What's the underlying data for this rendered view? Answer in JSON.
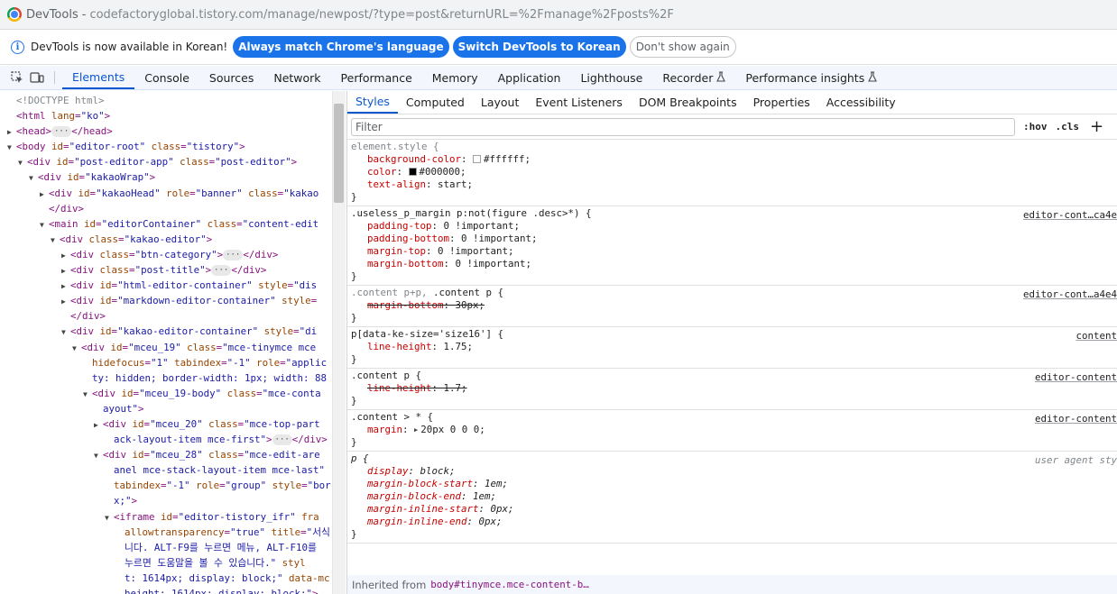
{
  "window": {
    "app_name": "DevTools",
    "separator": "-",
    "url": "codefactoryglobal.tistory.com/manage/newpost/?type=post&returnURL=%2Fmanage%2Fposts%2F"
  },
  "infobar": {
    "message": "DevTools is now available in Korean!",
    "btn_match": "Always match Chrome's language",
    "btn_switch": "Switch DevTools to Korean",
    "btn_dismiss": "Don't show again"
  },
  "main_tabs": [
    {
      "label": "Elements",
      "active": true
    },
    {
      "label": "Console"
    },
    {
      "label": "Sources"
    },
    {
      "label": "Network"
    },
    {
      "label": "Performance"
    },
    {
      "label": "Memory"
    },
    {
      "label": "Application"
    },
    {
      "label": "Lighthouse"
    },
    {
      "label": "Recorder",
      "flask": true
    },
    {
      "label": "Performance insights",
      "flask": true
    }
  ],
  "sub_tabs": [
    {
      "label": "Styles",
      "active": true
    },
    {
      "label": "Computed"
    },
    {
      "label": "Layout"
    },
    {
      "label": "Event Listeners"
    },
    {
      "label": "DOM Breakpoints"
    },
    {
      "label": "Properties"
    },
    {
      "label": "Accessibility"
    }
  ],
  "filter": {
    "placeholder": "Filter",
    "hov": ":hov",
    "cls": ".cls",
    "add": "+"
  },
  "dom_lines": [
    {
      "indent": 0,
      "html": "<span class='doctype'>&lt;!DOCTYPE html&gt;</span>"
    },
    {
      "indent": 0,
      "html": "<span class='tag'>&lt;html</span> <span class='attr'>lang</span><span class='tag'>=</span><span class='val'>\"ko\"</span><span class='tag'>&gt;</span>"
    },
    {
      "indent": 0,
      "tri": "▶",
      "html": "<span class='tag'>&lt;head&gt;</span><span class='ellipsis'>···</span><span class='tag'>&lt;/head&gt;</span>"
    },
    {
      "indent": 0,
      "tri": "▼",
      "html": "<span class='tag'>&lt;body</span> <span class='attr'>id</span><span class='tag'>=</span><span class='val'>\"editor-root\"</span> <span class='attr'>class</span><span class='tag'>=</span><span class='val'>\"tistory\"</span><span class='tag'>&gt;</span>"
    },
    {
      "indent": 1,
      "tri": "▼",
      "html": "<span class='tag'>&lt;div</span> <span class='attr'>id</span><span class='tag'>=</span><span class='val'>\"post-editor-app\"</span> <span class='attr'>class</span><span class='tag'>=</span><span class='val'>\"post-editor\"</span><span class='tag'>&gt;</span>"
    },
    {
      "indent": 2,
      "tri": "▼",
      "html": "<span class='tag'>&lt;div</span> <span class='attr'>id</span><span class='tag'>=</span><span class='val'>\"kakaoWrap\"</span><span class='tag'>&gt;</span>"
    },
    {
      "indent": 3,
      "tri": "▶",
      "html": "<span class='tag'>&lt;div</span> <span class='attr'>id</span><span class='tag'>=</span><span class='val'>\"kakaoHead\"</span> <span class='attr'>role</span><span class='tag'>=</span><span class='val'>\"banner\"</span> <span class='attr'>class</span><span class='tag'>=</span><span class='val'>\"kakao</span>"
    },
    {
      "indent": 3,
      "html": "<span class='tag'>&lt;/div&gt;</span>"
    },
    {
      "indent": 3,
      "tri": "▼",
      "html": "<span class='tag'>&lt;main</span> <span class='attr'>id</span><span class='tag'>=</span><span class='val'>\"editorContainer\"</span> <span class='attr'>class</span><span class='tag'>=</span><span class='val'>\"content-edit</span>"
    },
    {
      "indent": 4,
      "tri": "▼",
      "html": "<span class='tag'>&lt;div</span> <span class='attr'>class</span><span class='tag'>=</span><span class='val'>\"kakao-editor\"</span><span class='tag'>&gt;</span>"
    },
    {
      "indent": 5,
      "tri": "▶",
      "html": "<span class='tag'>&lt;div</span> <span class='attr'>class</span><span class='tag'>=</span><span class='val'>\"btn-category\"</span><span class='tag'>&gt;</span><span class='ellipsis'>···</span><span class='tag'>&lt;/div&gt;</span>"
    },
    {
      "indent": 5,
      "tri": "▶",
      "html": "<span class='tag'>&lt;div</span> <span class='attr'>class</span><span class='tag'>=</span><span class='val'>\"post-title\"</span><span class='tag'>&gt;</span><span class='ellipsis'>···</span><span class='tag'>&lt;/div&gt;</span>"
    },
    {
      "indent": 5,
      "tri": "▶",
      "html": "<span class='tag'>&lt;div</span> <span class='attr'>id</span><span class='tag'>=</span><span class='val'>\"html-editor-container\"</span> <span class='attr'>style</span><span class='tag'>=</span><span class='val'>\"dis</span>"
    },
    {
      "indent": 5,
      "tri": "▶",
      "html": "<span class='tag'>&lt;div</span> <span class='attr'>id</span><span class='tag'>=</span><span class='val'>\"markdown-editor-container\"</span> <span class='attr'>style</span><span class='tag'>=</span>"
    },
    {
      "indent": 5,
      "html": "<span class='tag'>&lt;/div&gt;</span>"
    },
    {
      "indent": 5,
      "tri": "▼",
      "html": "<span class='tag'>&lt;div</span> <span class='attr'>id</span><span class='tag'>=</span><span class='val'>\"kakao-editor-container\"</span> <span class='attr'>style</span><span class='tag'>=</span><span class='val'>\"di</span>"
    },
    {
      "indent": 6,
      "tri": "▼",
      "html": "<span class='tag'>&lt;div</span> <span class='attr'>id</span><span class='tag'>=</span><span class='val'>\"mceu_19\"</span> <span class='attr'>class</span><span class='tag'>=</span><span class='val'>\"mce-tinymce mce</span>"
    },
    {
      "indent": 7,
      "html": "<span class='attr'>hidefocus</span><span class='tag'>=</span><span class='val'>\"1\"</span> <span class='attr'>tabindex</span><span class='tag'>=</span><span class='val'>\"-1\"</span> <span class='attr'>role</span><span class='tag'>=</span><span class='val'>\"applic</span>"
    },
    {
      "indent": 7,
      "html": "<span class='val'>ty: hidden; border-width: 1px; width: 88</span>"
    },
    {
      "indent": 7,
      "tri": "▼",
      "html": "<span class='tag'>&lt;div</span> <span class='attr'>id</span><span class='tag'>=</span><span class='val'>\"mceu_19-body\"</span> <span class='attr'>class</span><span class='tag'>=</span><span class='val'>\"mce-conta</span>"
    },
    {
      "indent": 8,
      "html": "<span class='val'>ayout\"</span><span class='tag'>&gt;</span>"
    },
    {
      "indent": 8,
      "tri": "▶",
      "html": "<span class='tag'>&lt;div</span> <span class='attr'>id</span><span class='tag'>=</span><span class='val'>\"mceu_20\"</span> <span class='attr'>class</span><span class='tag'>=</span><span class='val'>\"mce-top-part</span>"
    },
    {
      "indent": 9,
      "html": "<span class='val'>ack-layout-item mce-first\"</span><span class='tag'>&gt;</span><span class='ellipsis'>···</span><span class='tag'>&lt;/div&gt;</span>"
    },
    {
      "indent": 8,
      "tri": "▼",
      "html": "<span class='tag'>&lt;div</span> <span class='attr'>id</span><span class='tag'>=</span><span class='val'>\"mceu_28\"</span> <span class='attr'>class</span><span class='tag'>=</span><span class='val'>\"mce-edit-are</span>"
    },
    {
      "indent": 9,
      "html": "<span class='val'>anel mce-stack-layout-item mce-last\"</span>"
    },
    {
      "indent": 9,
      "html": "<span class='attr'>tabindex</span><span class='tag'>=</span><span class='val'>\"-1\"</span> <span class='attr'>role</span><span class='tag'>=</span><span class='val'>\"group\"</span> <span class='attr'>style</span><span class='tag'>=</span><span class='val'>\"bor</span>"
    },
    {
      "indent": 9,
      "html": "<span class='val'>x;\"</span><span class='tag'>&gt;</span>"
    },
    {
      "indent": 9,
      "tri": "▼",
      "html": "<span class='tag'>&lt;iframe</span> <span class='attr'>id</span><span class='tag'>=</span><span class='val'>\"editor-tistory_ifr\"</span> <span class='attr'>fra</span>"
    },
    {
      "indent": 10,
      "html": "<span class='attr'>allowtransparency</span><span class='tag'>=</span><span class='val'>\"true\"</span> <span class='attr'>title</span><span class='tag'>=</span><span class='val'>\"서식</span>"
    },
    {
      "indent": 10,
      "html": "<span class='val'>니다. ALT-F9를 누르면 메뉴, ALT-F10를</span>"
    },
    {
      "indent": 10,
      "html": "<span class='val'>누르면 도움말을 볼 수 있습니다.\"</span> <span class='attr'>styl</span>"
    },
    {
      "indent": 10,
      "html": "<span class='val'>t: 1614px; display: block;\"</span> <span class='attr'>data-mc</span>"
    },
    {
      "indent": 10,
      "html": "<span class='val'>height: 1614px; display: block;\"</span><span class='tag'>&gt;</span>"
    }
  ],
  "rules": [
    {
      "selector": "element.style {",
      "dim": true,
      "decls": [
        {
          "prop": "background-color",
          "value": "#ffffff",
          "swatch": "#ffffff"
        },
        {
          "prop": "color",
          "value": "#000000",
          "swatch": "#000000"
        },
        {
          "prop": "text-align",
          "value": "start"
        }
      ]
    },
    {
      "selector": ".useless_p_margin p:not(figure .desc>*) {",
      "source": "editor-cont…ca4e",
      "decls": [
        {
          "prop": "padding-top",
          "value": "0 !important"
        },
        {
          "prop": "padding-bottom",
          "value": "0 !important"
        },
        {
          "prop": "margin-top",
          "value": "0 !important"
        },
        {
          "prop": "margin-bottom",
          "value": "0 !important"
        }
      ]
    },
    {
      "selector_dim": ".content p+p,",
      "selector": " .content p {",
      "source": "editor-cont…a4e4",
      "decls": [
        {
          "prop": "margin-bottom",
          "value": "30px",
          "struck": true
        }
      ]
    },
    {
      "selector": "p[data-ke-size='size16'] {",
      "source": "content",
      "decls": [
        {
          "prop": "line-height",
          "value": "1.75"
        }
      ]
    },
    {
      "selector": ".content p {",
      "source": "editor-content",
      "decls": [
        {
          "prop": "line-height",
          "value": "1.7",
          "struck": true
        }
      ]
    },
    {
      "selector": ".content > * {",
      "source": "editor-content",
      "decls": [
        {
          "prop": "margin",
          "value": "20px 0 0 0",
          "expander": true
        }
      ]
    },
    {
      "selector": "p {",
      "source": "user agent sty",
      "agent": true,
      "italic": true,
      "decls": [
        {
          "prop": "display",
          "value": "block"
        },
        {
          "prop": "margin-block-start",
          "value": "1em"
        },
        {
          "prop": "margin-block-end",
          "value": "1em"
        },
        {
          "prop": "margin-inline-start",
          "value": "0px"
        },
        {
          "prop": "margin-inline-end",
          "value": "0px"
        }
      ]
    }
  ],
  "inherited": {
    "label": "Inherited from",
    "selector": "body#tinymce.mce-content-b…"
  }
}
